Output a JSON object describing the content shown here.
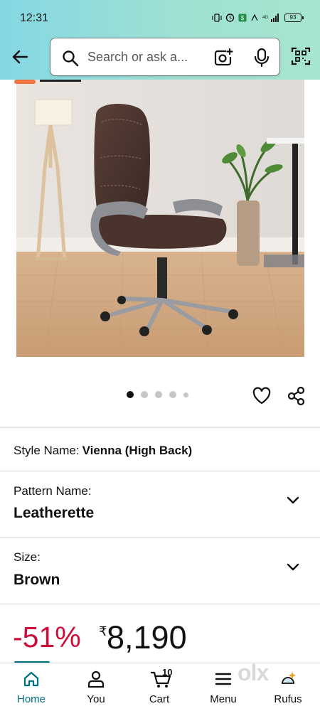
{
  "status_bar": {
    "time": "12:31",
    "battery": "93"
  },
  "header": {
    "search_placeholder": "Search or ask a...",
    "icons": [
      "back-arrow-icon",
      "search-icon",
      "camera-icon",
      "mic-icon",
      "barcode-scanner-icon"
    ]
  },
  "product": {
    "image_alt": "Brown leatherette high back office chair",
    "carousel": {
      "total": 5,
      "active": 0
    }
  },
  "style": {
    "label": "Style Name:",
    "value": "Vienna (High Back)"
  },
  "pattern": {
    "label": "Pattern Name:",
    "value": "Leatherette"
  },
  "size": {
    "label": "Size:",
    "value": "Brown"
  },
  "price": {
    "discount": "-51%",
    "currency": "₹",
    "amount": "8,190"
  },
  "bottom_nav": {
    "items": [
      {
        "label": "Home",
        "icon": "home-icon"
      },
      {
        "label": "You",
        "icon": "person-icon"
      },
      {
        "label": "Cart",
        "icon": "cart-icon"
      },
      {
        "label": "Menu",
        "icon": "menu-icon"
      },
      {
        "label": "Rufus",
        "icon": "rufus-icon"
      }
    ],
    "cart_count": "10",
    "active": "Home"
  },
  "watermark": "olx",
  "colors": {
    "accent": "#007185",
    "discount": "#cc0c39",
    "header_start": "#84d8e3",
    "header_end": "#a6e5cf"
  }
}
